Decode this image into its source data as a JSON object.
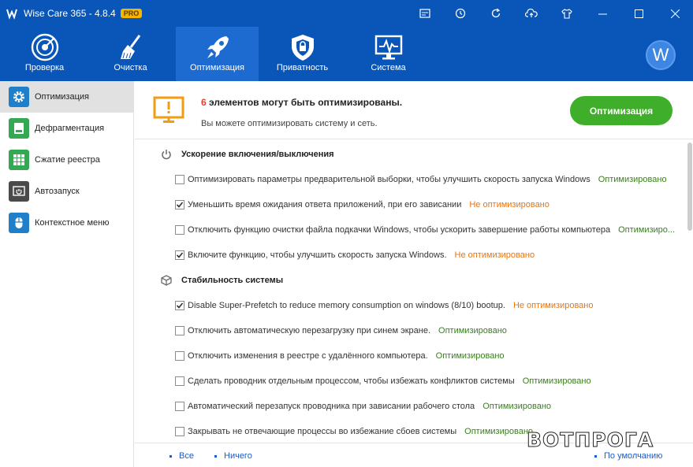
{
  "window": {
    "title": "Wise Care 365 - 4.8.4",
    "badge": "PRO",
    "icons": [
      "dashboard-icon",
      "history-icon",
      "refresh-icon",
      "cloud-upload-icon",
      "shirt-icon",
      "minimize-icon",
      "maximize-icon",
      "close-icon"
    ]
  },
  "nav": {
    "items": [
      {
        "label": "Проверка",
        "icon": "radar-icon"
      },
      {
        "label": "Очистка",
        "icon": "broom-icon"
      },
      {
        "label": "Оптимизация",
        "icon": "rocket-icon"
      },
      {
        "label": "Приватность",
        "icon": "shield-icon"
      },
      {
        "label": "Система",
        "icon": "monitor-icon"
      }
    ],
    "active": "Оптимизация",
    "avatar_letter": "W"
  },
  "sidebar": {
    "items": [
      {
        "label": "Оптимизация",
        "icon": "gear-icon",
        "color": "#1f7fc8"
      },
      {
        "label": "Дефрагментация",
        "icon": "disk-icon",
        "color": "#34a853"
      },
      {
        "label": "Сжатие реестра",
        "icon": "grid-icon",
        "color": "#34a853"
      },
      {
        "label": "Автозапуск",
        "icon": "power-icon",
        "color": "#4a4a4a"
      },
      {
        "label": "Контекстное меню",
        "icon": "mouse-icon",
        "color": "#1f7fc8"
      }
    ]
  },
  "summary": {
    "count": "6",
    "headline": " элементов могут быть оптимизированы.",
    "subtext": "Вы можете оптимизировать систему и сеть.",
    "button": "Оптимизация"
  },
  "sections": [
    {
      "title": "Ускорение включения/выключения",
      "icon": "power-icon",
      "rows": [
        {
          "text": "Оптимизировать параметры предварительной выборки, чтобы улучшить скорость запуска Windows",
          "status": "Оптимизировано",
          "checked": false
        },
        {
          "text": "Уменьшить время ожидания ответа приложений, при его зависании",
          "status": "Не оптимизировано",
          "checked": true
        },
        {
          "text": "Отключить функцию очистки файла подкачки Windows, чтобы ускорить завершение работы компьютера",
          "status": "Оптимизиро...",
          "checked": false
        },
        {
          "text": "Включите функцию, чтобы улучшить скорость запуска Windows.",
          "status": "Не оптимизировано",
          "checked": true
        }
      ]
    },
    {
      "title": "Стабильность системы",
      "icon": "cube-icon",
      "rows": [
        {
          "text": "Disable Super-Prefetch to reduce memory consumption on windows (8/10) bootup.",
          "status": "Не оптимизировано",
          "checked": true
        },
        {
          "text": "Отключить автоматическую перезагрузку при синем экране.",
          "status": "Оптимизировано",
          "checked": false
        },
        {
          "text": "Отключить изменения в реестре с удалённого компьютера.",
          "status": "Оптимизировано",
          "checked": false
        },
        {
          "text": "Сделать проводник отдельным процессом, чтобы избежать конфликтов системы",
          "status": "Оптимизировано",
          "checked": false
        },
        {
          "text": "Автоматический перезапуск проводника при зависании рабочего стола",
          "status": "Оптимизировано",
          "checked": false
        },
        {
          "text": "Закрывать не отвечающие процессы во избежание сбоев системы",
          "status": "Оптимизировано",
          "checked": false
        }
      ]
    }
  ],
  "footer": {
    "all": "Все",
    "none": "Ничего",
    "default": "По умолчанию"
  },
  "watermark": "ВОТПРОГА",
  "colors": {
    "brand": "#0a56b8",
    "accent_green": "#3fae2a",
    "optimized": "#3a7f1f",
    "not_optimized": "#e87510",
    "warning": "#f39c12"
  }
}
